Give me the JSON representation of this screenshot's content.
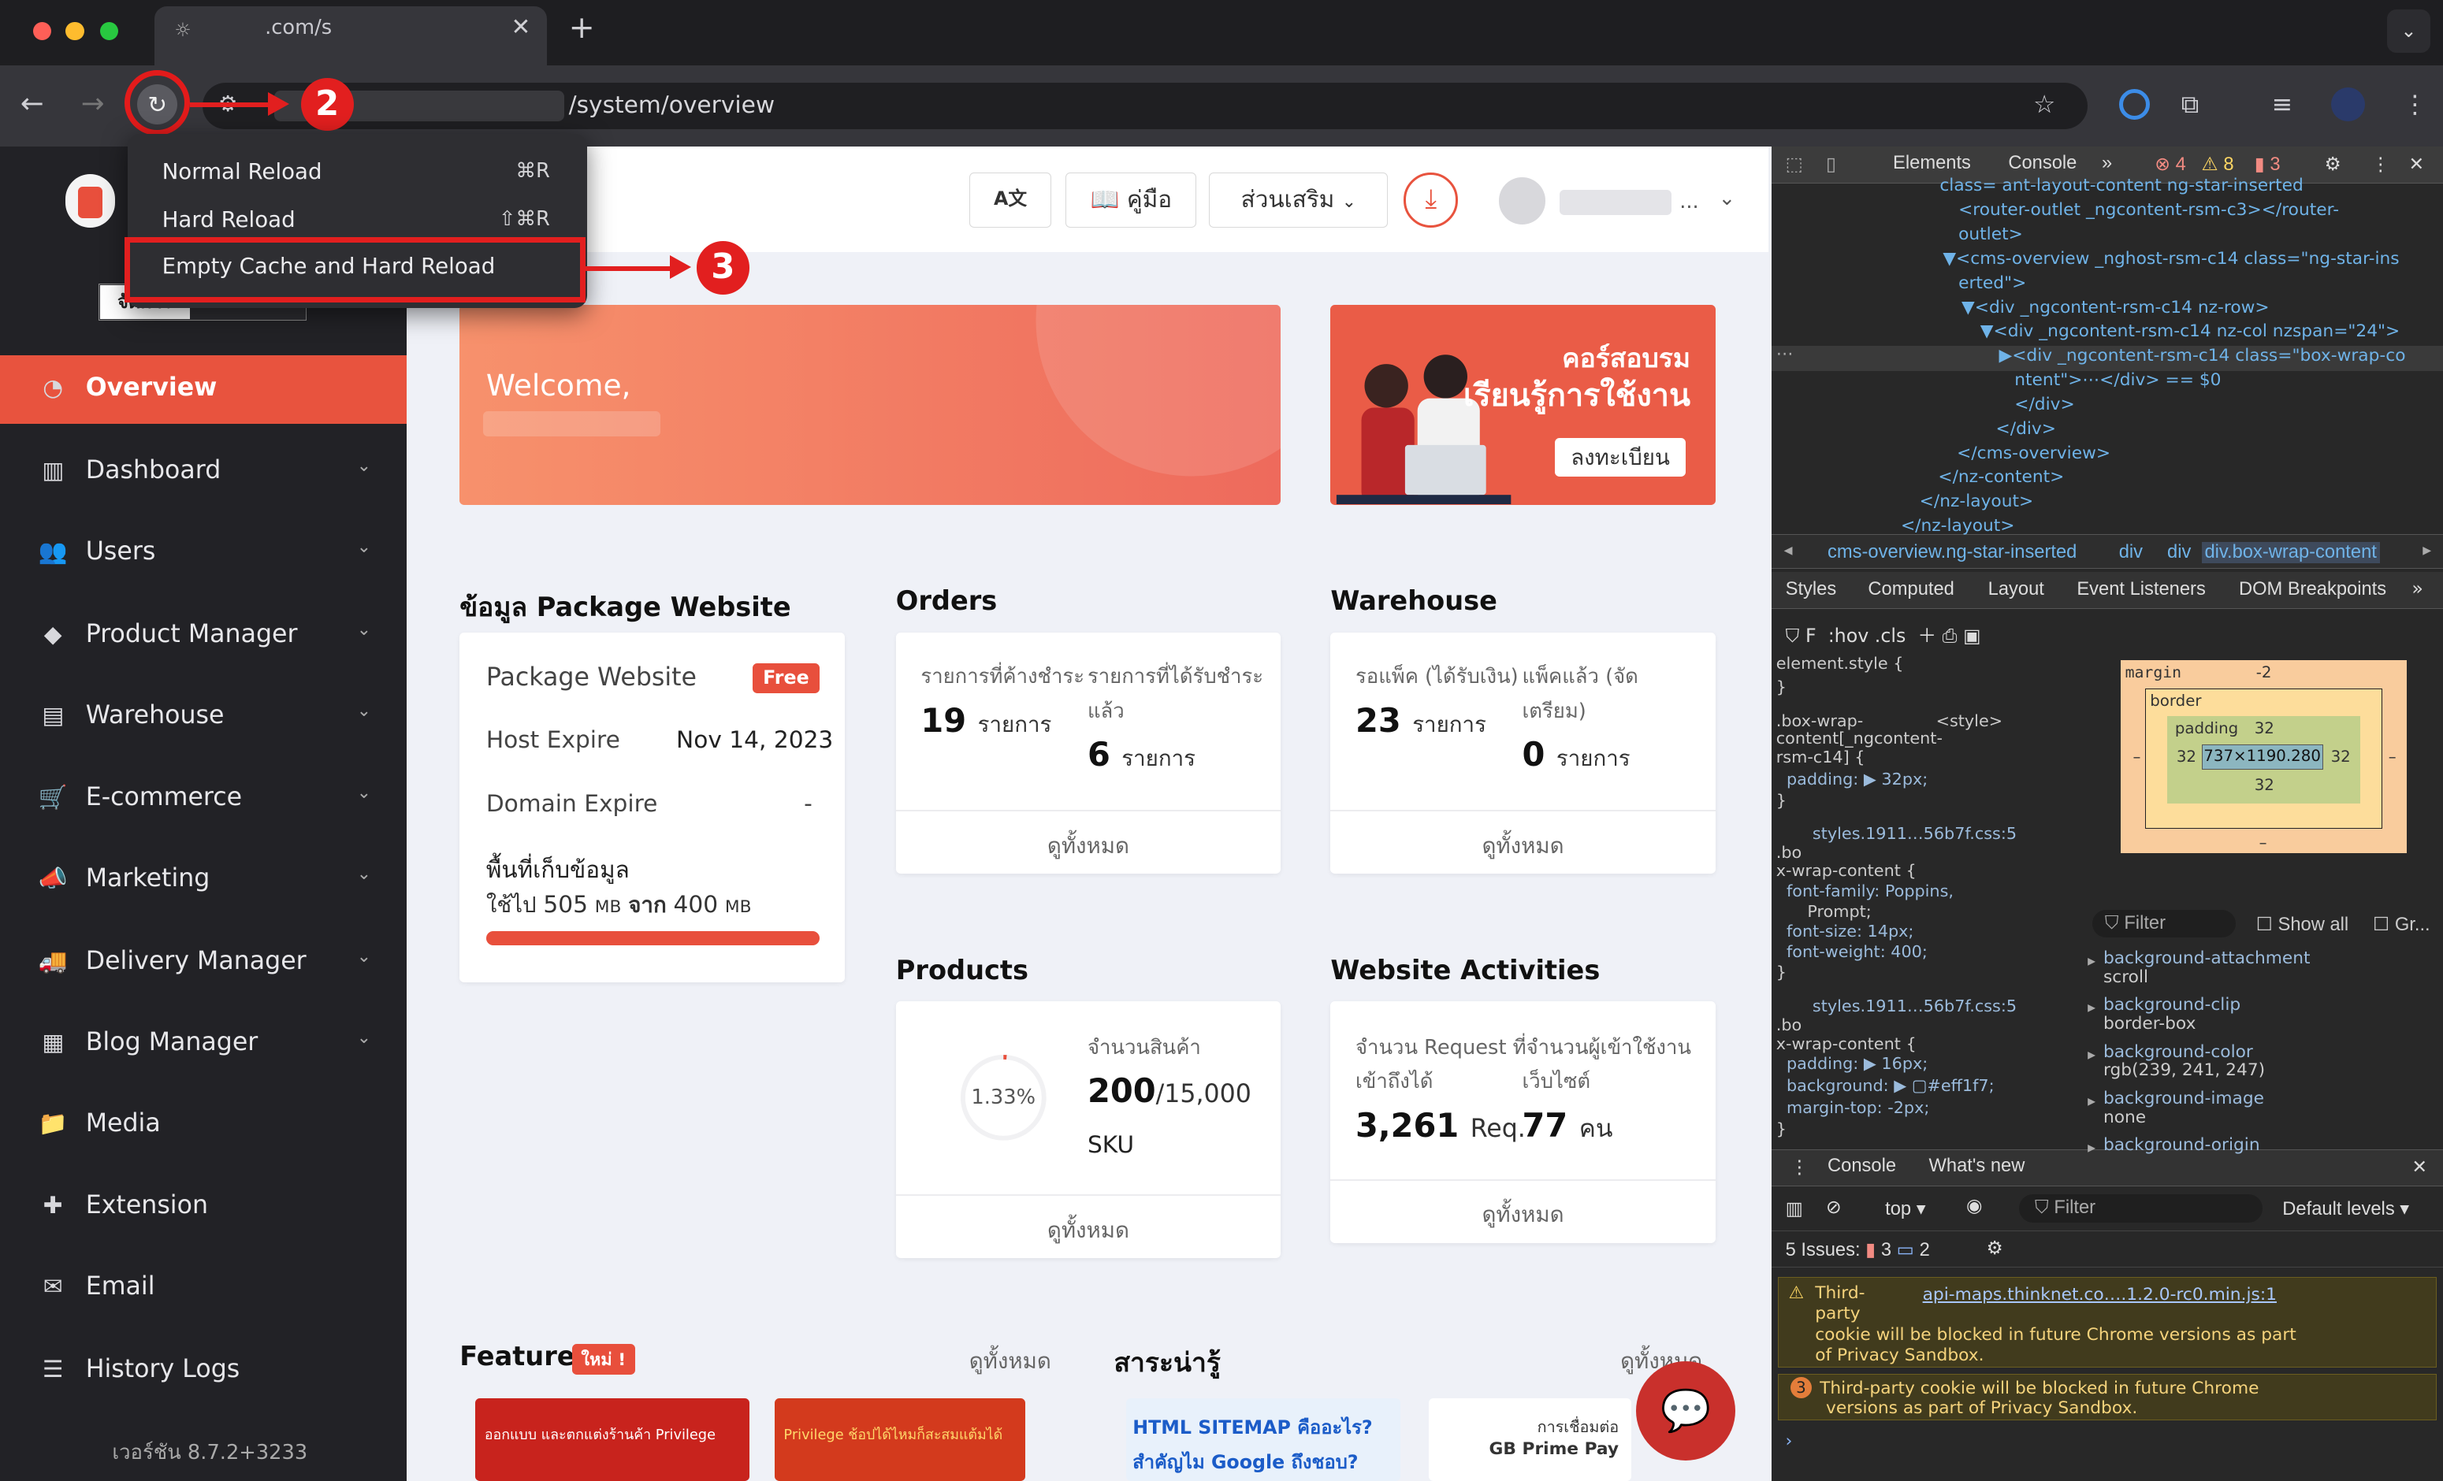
{
  "browser": {
    "tab_title": ".com/s",
    "url_path": "/system/overview",
    "issue_counts": {
      "errors": "4",
      "warnings": "8",
      "info": "3"
    }
  },
  "context_menu": {
    "items": [
      {
        "label": "Normal Reload",
        "shortcut": "⌘R"
      },
      {
        "label": "Hard Reload",
        "shortcut": "⇧⌘R"
      },
      {
        "label": "Empty Cache and Hard Reload",
        "shortcut": ""
      }
    ]
  },
  "annotations": {
    "step_reload": "2",
    "step_menu": "3",
    "accent_color": "#e21f1f"
  },
  "sidebar": {
    "sub_tab_active": "จัดการ",
    "sub_tab_other": "บริหาร",
    "items": [
      {
        "label": "Overview",
        "icon": "pie-chart-icon",
        "glyph": "◔",
        "has_arrow": false
      },
      {
        "label": "Dashboard",
        "icon": "bar-chart-icon",
        "glyph": "▥",
        "has_arrow": true
      },
      {
        "label": "Users",
        "icon": "users-icon",
        "glyph": "👥",
        "has_arrow": true
      },
      {
        "label": "Product Manager",
        "icon": "tag-icon",
        "glyph": "◆",
        "has_arrow": true
      },
      {
        "label": "Warehouse",
        "icon": "warehouse-icon",
        "glyph": "▤",
        "has_arrow": true
      },
      {
        "label": "E-commerce",
        "icon": "cart-icon",
        "glyph": "🛒",
        "has_arrow": true
      },
      {
        "label": "Marketing",
        "icon": "megaphone-icon",
        "glyph": "📣",
        "has_arrow": true
      },
      {
        "label": "Delivery Manager",
        "icon": "truck-icon",
        "glyph": "🚚",
        "has_arrow": true
      },
      {
        "label": "Blog Manager",
        "icon": "newspaper-icon",
        "glyph": "▦",
        "has_arrow": true
      },
      {
        "label": "Media",
        "icon": "folder-icon",
        "glyph": "📁",
        "has_arrow": false
      },
      {
        "label": "Extension",
        "icon": "puzzle-icon",
        "glyph": "✚",
        "has_arrow": false
      },
      {
        "label": "Email",
        "icon": "envelope-icon",
        "glyph": "✉",
        "has_arrow": false
      },
      {
        "label": "History Logs",
        "icon": "list-icon",
        "glyph": "☰",
        "has_arrow": false
      }
    ],
    "version": "เวอร์ชัน 8.7.2+3233"
  },
  "header": {
    "translate_label": "A文",
    "manual_label": "คู่มือ",
    "addons_label": "ส่วนเสริม",
    "user_dots": "..."
  },
  "welcome": {
    "text": "Welcome,"
  },
  "course_banner": {
    "line1": "คอร์สอบรม",
    "line2": "เรียนรู้การใช้งาน",
    "button": "ลงทะเบียน"
  },
  "package": {
    "section_title": "ข้อมูล Package Website",
    "name": "Package Website",
    "badge": "Free",
    "host_label": "Host Expire",
    "host_value": "Nov 14, 2023",
    "domain_label": "Domain Expire",
    "domain_value": "-",
    "storage_label": "พื้นที่เก็บข้อมูล",
    "storage_used_prefix": "ใช้ไป",
    "storage_used": "505",
    "storage_unit": "MB",
    "storage_of": "จาก",
    "storage_total": "400",
    "storage_fraction": 1.0
  },
  "orders": {
    "title": "Orders",
    "pending_label": "รายการที่ค้างชำระ",
    "pending_value": "19",
    "pending_unit": "รายการ",
    "paid_label_1": "รายการที่ได้รับชำระ",
    "paid_label_2": "แล้ว",
    "paid_value": "6",
    "paid_unit": "รายการ",
    "view_all": "ดูทั้งหมด"
  },
  "warehouse": {
    "title": "Warehouse",
    "waiting_label": "รอแพ็ค (ได้รับเงิน)",
    "waiting_value": "23",
    "waiting_unit": "รายการ",
    "packed_label_1": "แพ็คแล้ว (จัด",
    "packed_label_2": "เตรียม)",
    "packed_value": "0",
    "packed_unit": "รายการ",
    "view_all": "ดูทั้งหมด"
  },
  "products": {
    "title": "Products",
    "percent": "1.33%",
    "count_label": "จำนวนสินค้า",
    "count": "200",
    "limit": "/15,000",
    "unit": "SKU",
    "view_all": "ดูทั้งหมด"
  },
  "activities": {
    "title": "Website Activities",
    "req_label_1": "จำนวน Request ที่",
    "req_label_2": "เข้าถึงได้",
    "req_value": "3,261",
    "req_unit": "Req.",
    "users_label_1": "จำนวนผู้เข้าใช้งาน",
    "users_label_2": "เว็บไซต์",
    "users_value": "77",
    "users_unit": "คน",
    "view_all": "ดูทั้งหมด"
  },
  "feature": {
    "title": "Feature",
    "badge": "ใหม่ !",
    "view_all": "ดูทั้งหมด",
    "card1": "ออกแบบ และตกแต่งร้านค้า Privilege",
    "card2": "Privilege ช้อปได้ไหมก็สะสมแต้มได้"
  },
  "knowledge": {
    "title": "สาระน่ารู้",
    "view_all": "ดูทั้งหมด",
    "card1_line1": "HTML SITEMAP คืออะไร?",
    "card1_line2": "สำคัญไม Google ถึงชอบ?",
    "card2_line1": "การเชื่อมต่อ",
    "card2_line2": "GB Prime Pay"
  },
  "devtools": {
    "tabs": [
      "Elements",
      "Console"
    ],
    "dom_lines": [
      "class= ant-layout-content ng-star-inserted",
      "<router-outlet _ngcontent-rsm-c3></router-",
      "outlet>",
      "▼<cms-overview _nghost-rsm-c14 class=\"ng-star-ins",
      "erted\">",
      "▼<div _ngcontent-rsm-c14 nz-row>",
      "▼<div _ngcontent-rsm-c14 nz-col nzspan=\"24\">",
      "▶<div _ngcontent-rsm-c14 class=\"box-wrap-co",
      "ntent\">⋯</div> == $0",
      "</div>",
      "</div>",
      "</cms-overview>",
      "</nz-content>",
      "</nz-layout>",
      "</nz-layout>"
    ],
    "breadcrumb": [
      "cms-overview.ng-star-inserted",
      "div",
      "div",
      "div.box-wrap-content"
    ],
    "panel_tabs": [
      "Styles",
      "Computed",
      "Layout",
      "Event Listeners",
      "DOM Breakpoints"
    ],
    "styles_lines": [
      "element.style {",
      "}",
      ".box-wrap-              <style>",
      "content[_ngcontent-",
      "rsm-c14] {",
      "  padding: ▶ 32px;",
      "}",
      "       styles.1911…56b7f.css:5",
      ".bo",
      "x-wrap-content {",
      "  font-family: Poppins,",
      "      Prompt;",
      "  font-size: 14px;",
      "  font-weight: 400;",
      "}",
      "       styles.1911…56b7f.css:5",
      ".bo",
      "x-wrap-content {",
      "  padding: ▶ 16px;",
      "  background: ▶ ▢#eff1f7;",
      "  margin-top: -2px;",
      "}"
    ],
    "box_model": {
      "margin_label": "margin",
      "margin": "-2",
      "border_label": "border",
      "padding_label": "padding",
      "padding": "32",
      "content": "737×1190.280",
      "dash": "–"
    },
    "computed_filter": "Filter",
    "show_all": "Show all",
    "group": "Gr...",
    "computed": [
      {
        "prop": "background-attachment",
        "val": "scroll"
      },
      {
        "prop": "background-clip",
        "val": "border-box"
      },
      {
        "prop": "background-color",
        "val": "rgb(239, 241, 247)"
      },
      {
        "prop": "background-image",
        "val": "none"
      },
      {
        "prop": "background-origin",
        "val": ""
      }
    ],
    "console_tabs": [
      "Console",
      "What's new"
    ],
    "console_context": "top ▾",
    "console_filter": "Filter",
    "levels": "Default levels ▾",
    "issues": "5 Issues:",
    "issues_warn": "3",
    "issues_info": "2",
    "msg1_source": "api-maps.thinknet.co….1.2.0-rc0.min.js:1",
    "msg1": [
      "Third-",
      "party",
      "cookie will be blocked in future Chrome versions as part",
      "of Privacy Sandbox."
    ],
    "msg2_count": "3",
    "msg2": [
      "Third-party cookie will be blocked in future Chrome",
      "versions as part of Privacy Sandbox."
    ]
  }
}
